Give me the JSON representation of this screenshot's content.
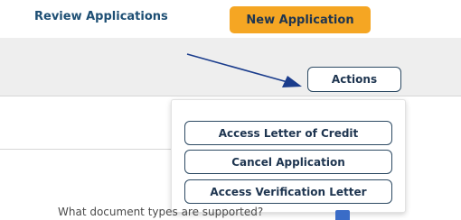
{
  "tabs": {
    "review": "Review Applications",
    "new": "New Application"
  },
  "actions_button": "Actions",
  "menu": {
    "items": [
      "Access Letter of Credit",
      "Cancel Application",
      "Access Verification Letter"
    ]
  },
  "faq": {
    "question": "What document types are supported?",
    "icon": "help-icon"
  },
  "colors": {
    "accent_orange": "#f5a623",
    "navy": "#1e3550",
    "arrow": "#1a3c8c"
  }
}
